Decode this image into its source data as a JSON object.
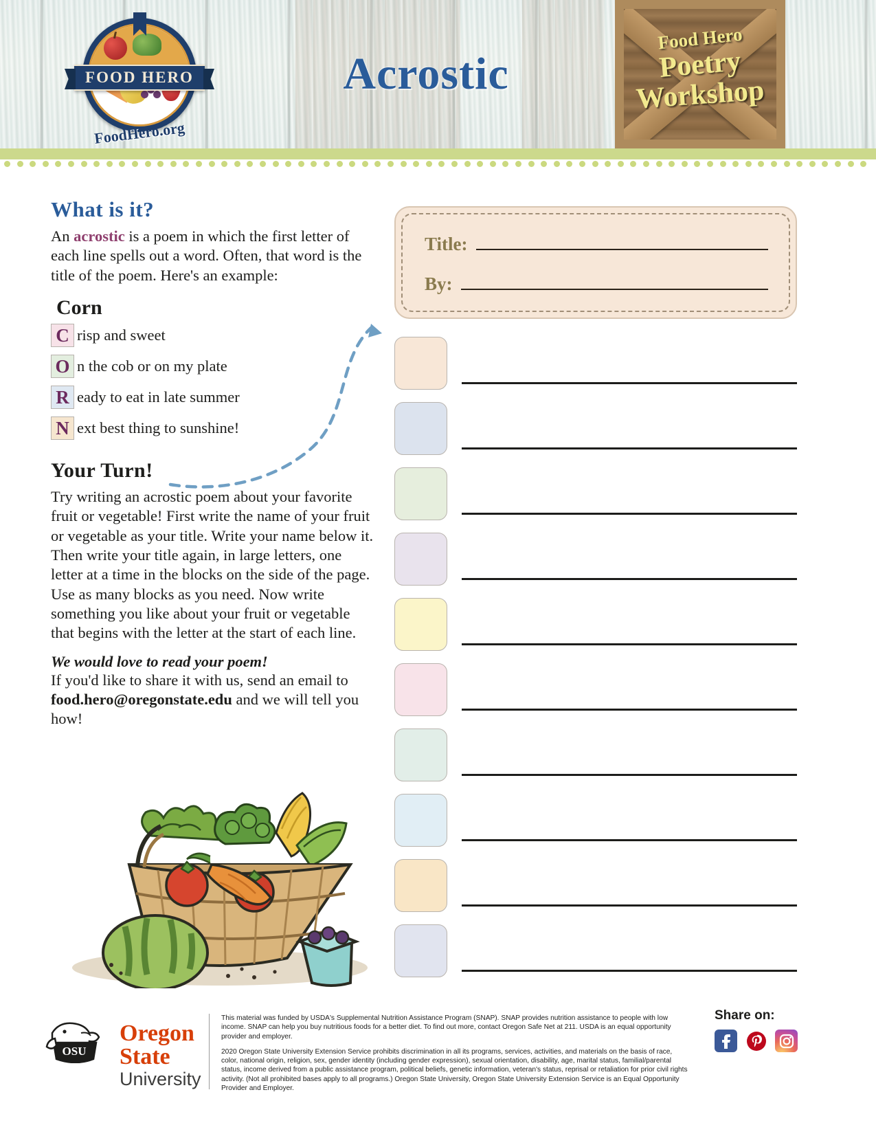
{
  "header": {
    "logo_name": "FOOD HERO",
    "logo_url": "FoodHero.org",
    "title": "Acrostic",
    "crate_line1": "Food Hero",
    "crate_line2": "Poetry",
    "crate_line3": "Workshop"
  },
  "what_is_it": {
    "heading": "What is it?",
    "body_pre": "An ",
    "body_highlight": "acrostic",
    "body_post": " is a poem in which the first letter of each line spells out a word. Often, that word is the title of the poem. Here's an example:"
  },
  "example": {
    "title": "Corn",
    "lines": [
      {
        "letter": "C",
        "text": "risp and sweet",
        "color": "#f7e2e8"
      },
      {
        "letter": "O",
        "text": "n the cob or on my plate",
        "color": "#e3eedf"
      },
      {
        "letter": "R",
        "text": "eady to eat in late summer",
        "color": "#dfe8f2"
      },
      {
        "letter": "N",
        "text": "ext best thing to sunshine!",
        "color": "#f6e6cf"
      }
    ]
  },
  "your_turn": {
    "heading": "Your Turn!",
    "body": "Try writing an acrostic poem about your favorite fruit or vegetable! First write the name of your fruit or vegetable as your title. Write your name below it. Then write your title again, in large letters, one letter at a time in the blocks on the side of the page. Use as many blocks as you need. Now write something you like about your fruit or vegetable that begins with the letter at the start of each line."
  },
  "share_invite": {
    "heading": "We would love to read your poem!",
    "body_pre": "If you'd like to share it with us, send an email to ",
    "email": "food.hero@oregonstate.edu",
    "body_post": " and we will tell you how!"
  },
  "worksheet": {
    "title_label": "Title:",
    "by_label": "By:",
    "blocks": [
      {
        "color": "#f8e7d7"
      },
      {
        "color": "#dce3ee"
      },
      {
        "color": "#e6eedd"
      },
      {
        "color": "#e9e3ed"
      },
      {
        "color": "#fbf5c9"
      },
      {
        "color": "#f8e3e9"
      },
      {
        "color": "#e2eee8"
      },
      {
        "color": "#e1eef5"
      },
      {
        "color": "#f9e6c6"
      },
      {
        "color": "#e1e4ef"
      }
    ]
  },
  "footer": {
    "osu_line1": "Oregon State",
    "osu_line2": "University",
    "disclaimer_1": "This material was funded by USDA's Supplemental Nutrition Assistance Program (SNAP). SNAP provides nutrition assistance to people with low income. SNAP can help you buy nutritious foods for a better diet. To find out more, contact Oregon Safe Net at 211. USDA is an equal opportunity provider and employer.",
    "disclaimer_2": "2020 Oregon State University Extension Service prohibits discrimination in all its programs, services, activities, and materials on the basis of race, color, national origin, religion, sex, gender identity (including gender expression), sexual orientation, disability, age, marital status, familial/parental status, income derived from a public assistance program, political beliefs, genetic information, veteran's status, reprisal or retaliation for prior civil rights activity. (Not all prohibited bases apply to all programs.) Oregon State University, Oregon State University Extension Service is an Equal Opportunity Provider and Employer.",
    "share_label": "Share on:"
  },
  "colors": {
    "brand_blue": "#2a5c9a",
    "accent_purple": "#8f3f6e",
    "osu_orange": "#d73f09",
    "crate_yellow": "#f2e98e",
    "band_green": "#ccd98c"
  }
}
